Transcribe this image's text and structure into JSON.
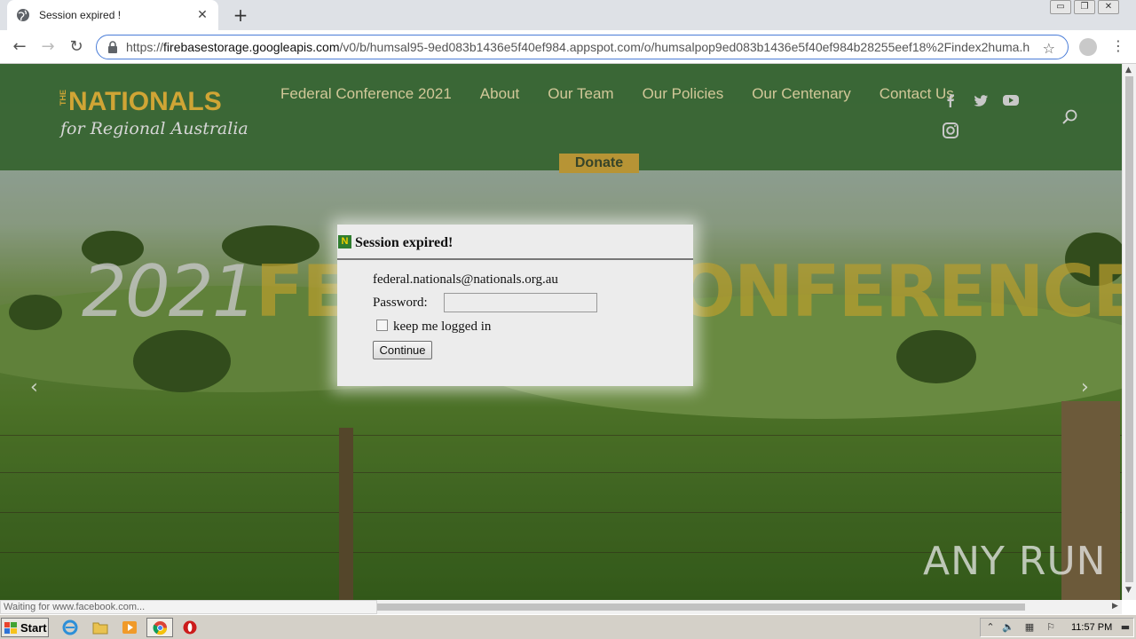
{
  "browser": {
    "tab_title": "Session expired !",
    "url_scheme": "https://",
    "url_host": "firebasestorage.googleapis.com",
    "url_path": "/v0/b/humsal95-9ed083b1436e5f40ef984.appspot.com/o/humsalpop9ed083b1436e5f40ef984b28255eef18%2Findex2huma.h",
    "status_text": "Waiting for www.facebook.com..."
  },
  "site": {
    "logo_the": "THE",
    "logo_main": "NATIONALS",
    "logo_sub": "for Regional Australia",
    "nav": [
      "Federal Conference 2021",
      "About",
      "Our Team",
      "Our Policies",
      "Our Centenary",
      "Contact Us"
    ],
    "donate_label": "Donate",
    "hero_year": "2021",
    "hero_word": "FEDERAL CONFERENCE",
    "social_icons": [
      "facebook-icon",
      "twitter-icon",
      "youtube-icon",
      "instagram-icon"
    ]
  },
  "modal": {
    "title": "Session expired!",
    "icon_letter": "N",
    "email": "federal.nationals@nationals.org.au",
    "password_label": "Password:",
    "password_value": "",
    "remember_label": "keep me logged in",
    "remember_checked": false,
    "continue_label": "Continue"
  },
  "watermark": "ANY RUN",
  "taskbar": {
    "start_label": "Start",
    "clock": "11:57 PM"
  },
  "colors": {
    "header_green": "#3a6c34",
    "nav_text": "#e4d9a6",
    "donate_bg": "#c7a13a",
    "logo_gold": "#e2b43a",
    "omnibox_border": "#4a7dd8"
  }
}
